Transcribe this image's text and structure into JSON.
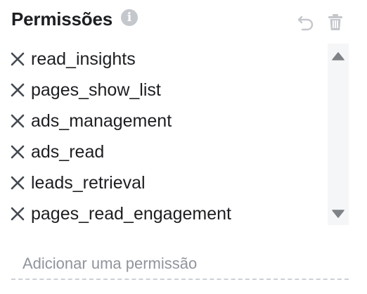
{
  "header": {
    "title": "Permissões"
  },
  "icons": {
    "info": "info-icon",
    "undo": "undo-icon",
    "trash": "trash-icon",
    "remove": "close-icon",
    "scroll_up": "triangle-up-icon",
    "scroll_down": "triangle-down-icon"
  },
  "permissions": [
    {
      "label": "read_insights"
    },
    {
      "label": "pages_show_list"
    },
    {
      "label": "ads_management"
    },
    {
      "label": "ads_read"
    },
    {
      "label": "leads_retrieval"
    },
    {
      "label": "pages_read_engagement"
    }
  ],
  "add_input": {
    "placeholder": "Adicionar uma permissão",
    "value": ""
  },
  "colors": {
    "text": "#1c1e21",
    "icon_muted": "#c4c7cc",
    "icon_dark": "#444950",
    "scroll_track": "#f5f6f7",
    "scroll_arrow": "#7f8287",
    "placeholder": "#90949c",
    "divider": "#ccd0d5"
  }
}
